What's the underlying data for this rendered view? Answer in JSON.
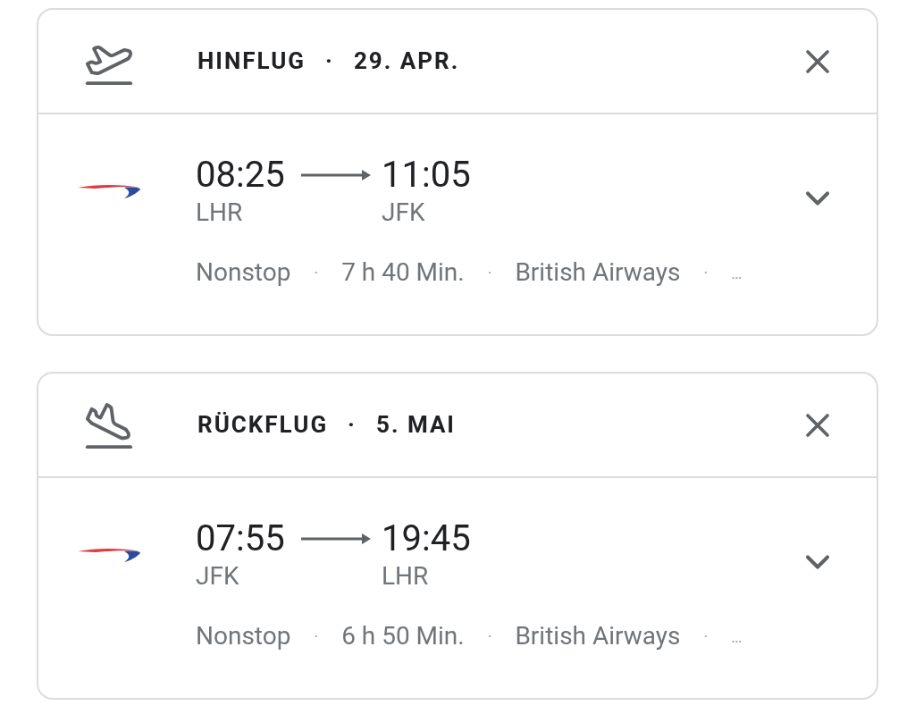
{
  "flights": [
    {
      "kind": "departure",
      "direction": "HINFLUG",
      "separator": "·",
      "date": "29. APR.",
      "segments": [
        {
          "depart_time": "08:25",
          "arrive_time": "11:05",
          "from": "LHR",
          "to": "JFK",
          "details": [
            "Nonstop",
            "·",
            "7 h 40 Min.",
            "·",
            "British Airways",
            "·",
            "…"
          ]
        }
      ]
    },
    {
      "kind": "return",
      "direction": "RÜCKFLUG",
      "separator": "·",
      "date": "5. MAI",
      "segments": [
        {
          "depart_time": "07:55",
          "arrive_time": "19:45",
          "from": "JFK",
          "to": "LHR",
          "details": [
            "Nonstop",
            "·",
            "6 h 50 Min.",
            "·",
            "British Airways",
            "·",
            "…"
          ]
        }
      ]
    }
  ]
}
